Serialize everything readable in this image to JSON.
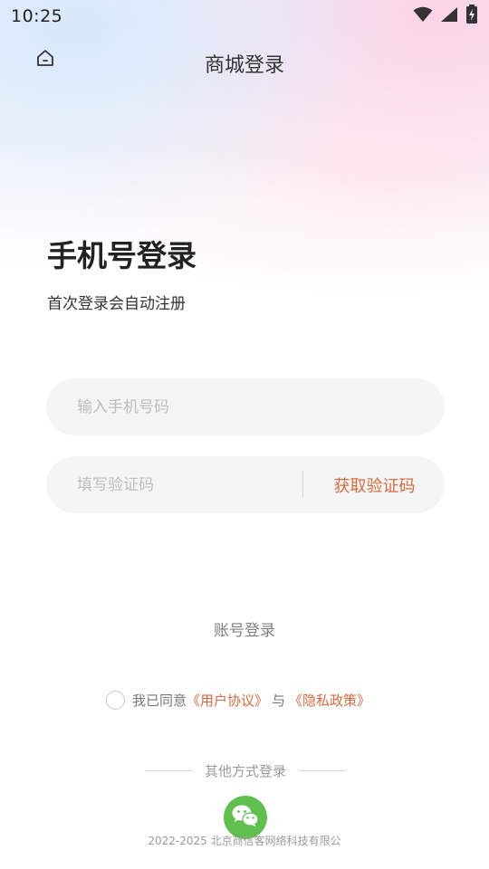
{
  "status_bar": {
    "time": "10:25",
    "icons": [
      "wifi-icon",
      "signal-icon",
      "battery-charging-icon"
    ]
  },
  "header": {
    "home_icon": "home-icon",
    "title": "商城登录"
  },
  "login": {
    "title": "手机号登录",
    "subtitle": "首次登录会自动注册",
    "phone_placeholder": "输入手机号码",
    "phone_value": "",
    "code_placeholder": "填写验证码",
    "code_value": "",
    "get_code_label": "获取验证码",
    "account_login_label": "账号登录"
  },
  "agreement": {
    "prefix": "我已同意",
    "user_agreement": "《用户协议》",
    "and": "与",
    "privacy_policy": "《隐私政策》",
    "checked": false
  },
  "other_login": {
    "label": "其他方式登录",
    "wechat_icon": "wechat-icon"
  },
  "footer": {
    "copyright": "2022-2025 北京商信客网络科技有限公"
  },
  "colors": {
    "accent": "#d9693f",
    "wechat": "#5fc04d",
    "field_bg": "#f5f5f5"
  }
}
